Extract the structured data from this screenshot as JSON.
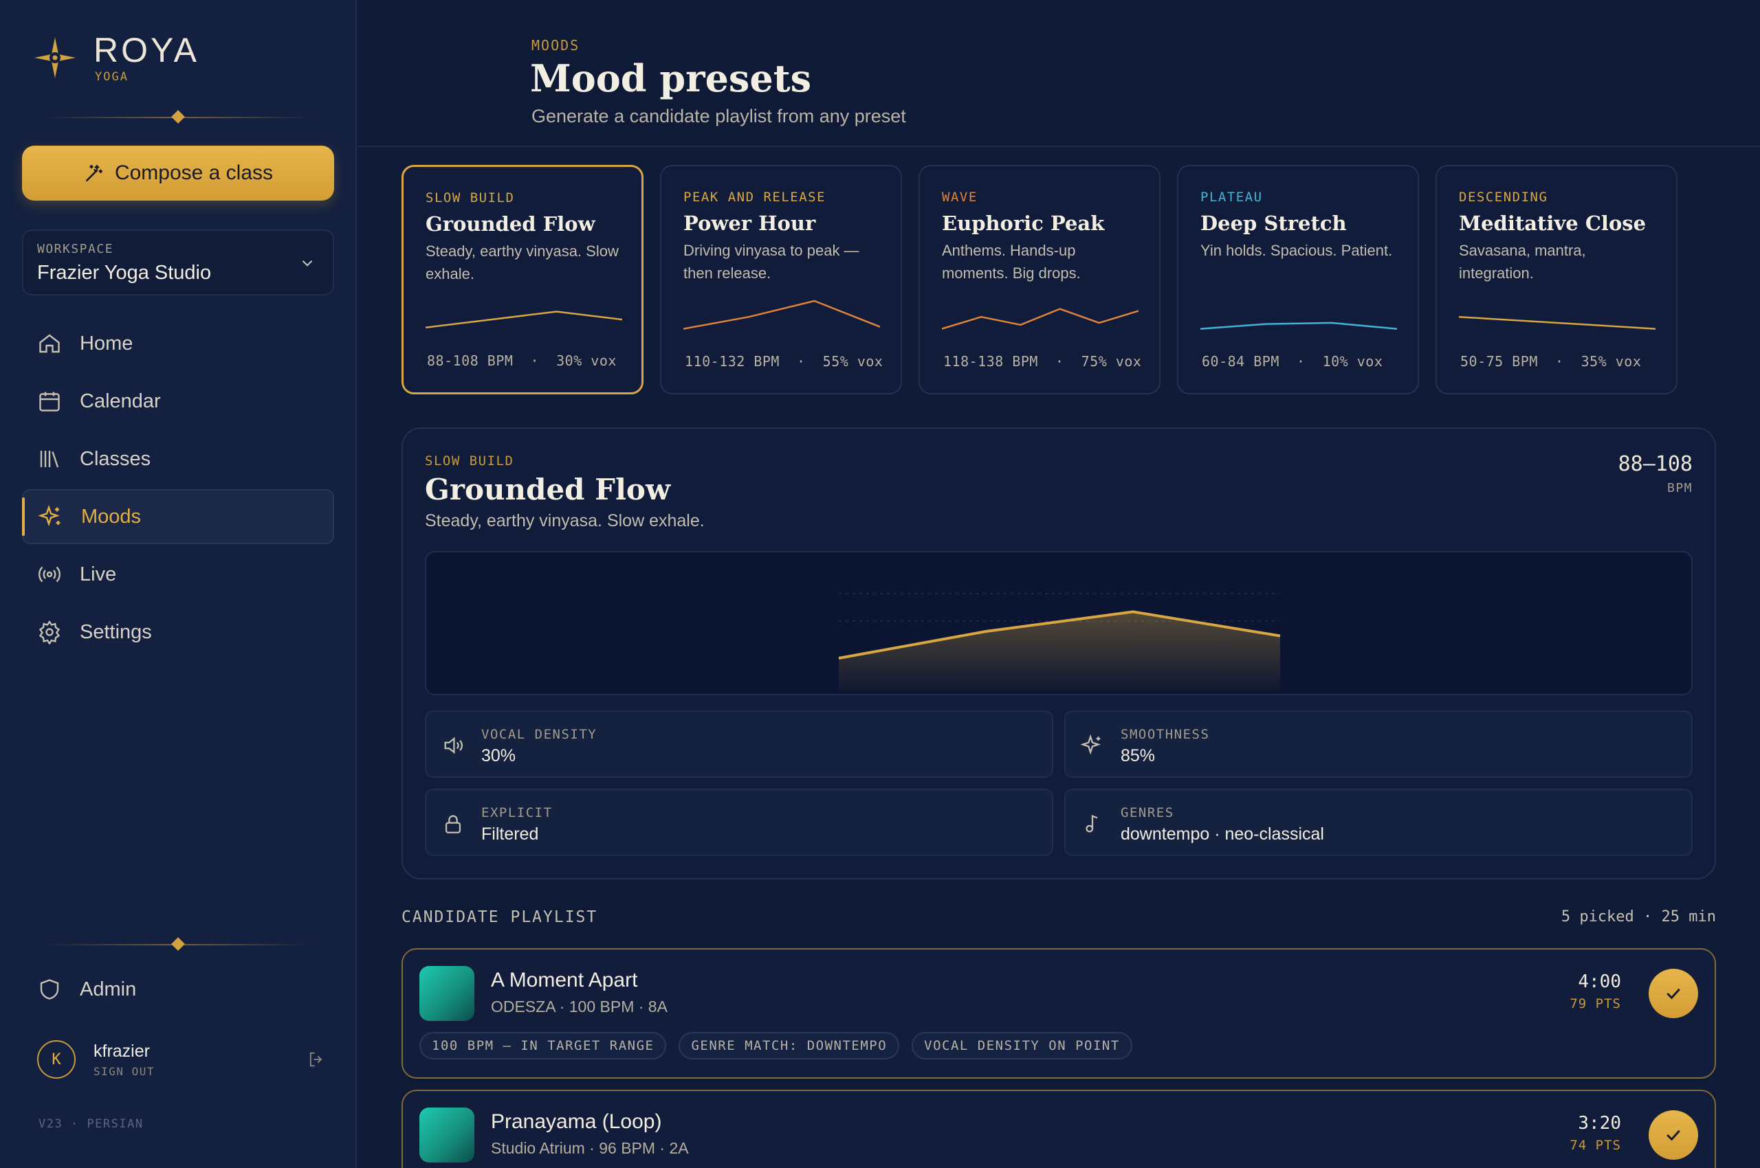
{
  "brand": {
    "name": "ROYA",
    "sub": "YOGA",
    "accent": "#d8a743"
  },
  "sidebar": {
    "compose_label": "Compose a class",
    "workspace_label": "WORKSPACE",
    "workspace_name": "Frazier Yoga Studio",
    "nav": [
      {
        "label": "Home",
        "icon": "home-icon"
      },
      {
        "label": "Calendar",
        "icon": "calendar-icon"
      },
      {
        "label": "Classes",
        "icon": "library-icon"
      },
      {
        "label": "Moods",
        "icon": "sparkle-icon",
        "active": true
      },
      {
        "label": "Live",
        "icon": "broadcast-icon"
      },
      {
        "label": "Settings",
        "icon": "gear-icon"
      }
    ],
    "admin_label": "Admin",
    "user": {
      "initial": "K",
      "name": "kfrazier",
      "signout": "SIGN OUT"
    },
    "version": "V23 · PERSIAN"
  },
  "header": {
    "crumb": "MOODS",
    "title": "Mood presets",
    "subtitle": "Generate a candidate playlist from any preset"
  },
  "presets": [
    {
      "tag": "SLOW BUILD",
      "tag_color": "#d8a743",
      "name": "Grounded Flow",
      "desc": "Steady, earthy vinyasa. Slow exhale.",
      "bpm": "88-108 BPM",
      "vox": "30% vox",
      "line_color": "#d8a743",
      "curve": [
        0.35,
        0.55,
        0.75,
        0.55
      ],
      "selected": true
    },
    {
      "tag": "PEAK AND RELEASE",
      "tag_color": "#d8a743",
      "name": "Power Hour",
      "desc": "Driving vinyasa to peak — then release.",
      "bpm": "110-132 BPM",
      "vox": "55% vox",
      "line_color": "#e0843c",
      "curve": [
        0.3,
        0.6,
        1.0,
        0.35
      ]
    },
    {
      "tag": "WAVE",
      "tag_color": "#e0843c",
      "name": "Euphoric Peak",
      "desc": "Anthems. Hands-up moments. Big drops.",
      "bpm": "118-138 BPM",
      "vox": "75% vox",
      "line_color": "#e0843c",
      "curve": [
        0.3,
        0.6,
        0.4,
        0.8,
        0.45,
        0.75
      ]
    },
    {
      "tag": "PLATEAU",
      "tag_color": "#46b3d6",
      "name": "Deep Stretch",
      "desc": "Yin holds. Spacious. Patient.",
      "bpm": "60-84 BPM",
      "vox": "10% vox",
      "line_color": "#46b3d6",
      "curve": [
        0.3,
        0.42,
        0.45,
        0.3
      ]
    },
    {
      "tag": "DESCENDING",
      "tag_color": "#d8a743",
      "name": "Meditative Close",
      "desc": "Savasana, mantra, integration.",
      "bpm": "50-75 BPM",
      "vox": "35% vox",
      "line_color": "#d8a743",
      "curve": [
        0.6,
        0.5,
        0.4,
        0.3
      ]
    }
  ],
  "detail": {
    "tag": "SLOW BUILD",
    "name": "Grounded Flow",
    "desc": "Steady, earthy vinyasa. Slow exhale.",
    "bpm": "88–108",
    "bpm_label": "BPM",
    "curve": [
      0.2,
      0.5,
      0.72,
      0.45
    ],
    "stats": [
      {
        "label": "VOCAL DENSITY",
        "value": "30%",
        "icon": "speaker-icon"
      },
      {
        "label": "SMOOTHNESS",
        "value": "85%",
        "icon": "sparkle-icon"
      },
      {
        "label": "EXPLICIT",
        "value": "Filtered",
        "icon": "lock-icon"
      },
      {
        "label": "GENRES",
        "value": "downtempo · neo-classical",
        "icon": "music-note-icon"
      }
    ]
  },
  "candidates": {
    "heading": "CANDIDATE PLAYLIST",
    "summary": "5 picked · 25 min",
    "tracks": [
      {
        "title": "A Moment Apart",
        "meta": "ODESZA · 100 BPM · 8A",
        "duration": "4:00",
        "points": "79 PTS",
        "chips": [
          "100 BPM — IN TARGET RANGE",
          "GENRE MATCH: DOWNTEMPO",
          "VOCAL DENSITY ON POINT"
        ]
      },
      {
        "title": "Pranayama (Loop)",
        "meta": "Studio Atrium · 96 BPM · 2A",
        "duration": "3:20",
        "points": "74 PTS",
        "chips": []
      }
    ]
  }
}
